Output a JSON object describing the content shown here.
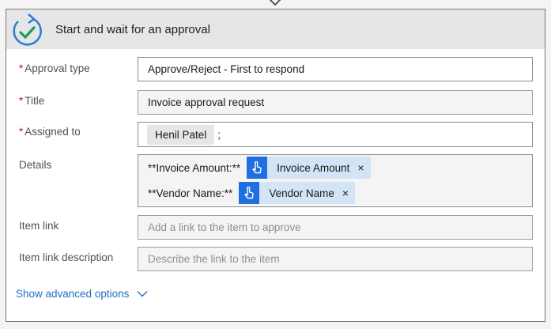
{
  "card": {
    "title": "Start and wait for an approval",
    "icon": "approval-check-icon"
  },
  "fields": {
    "approval_type": {
      "label": "Approval type",
      "required": "*",
      "value": "Approve/Reject - First to respond"
    },
    "title": {
      "label": "Title",
      "required": "*",
      "value": "Invoice approval request"
    },
    "assigned_to": {
      "label": "Assigned to",
      "required": "*",
      "chip": "Henil Patel",
      "separator": ";"
    },
    "details": {
      "label": "Details",
      "line1_text": "**Invoice Amount:**",
      "line1_token": "Invoice Amount",
      "line2_text": "**Vendor Name:**",
      "line2_token": "Vendor Name",
      "token_close": "×",
      "token_icon": "touch-hand-icon"
    },
    "item_link": {
      "label": "Item link",
      "placeholder": "Add a link to the item to approve"
    },
    "item_link_description": {
      "label": "Item link description",
      "placeholder": "Describe the link to the item"
    }
  },
  "advanced": {
    "label": "Show advanced options",
    "icon": "chevron-down-icon"
  },
  "colors": {
    "accent": "#1f6fc2",
    "token_bg": "#d3e4f6",
    "token_icon_bg": "#1f6fe0",
    "required": "#b0191e"
  }
}
